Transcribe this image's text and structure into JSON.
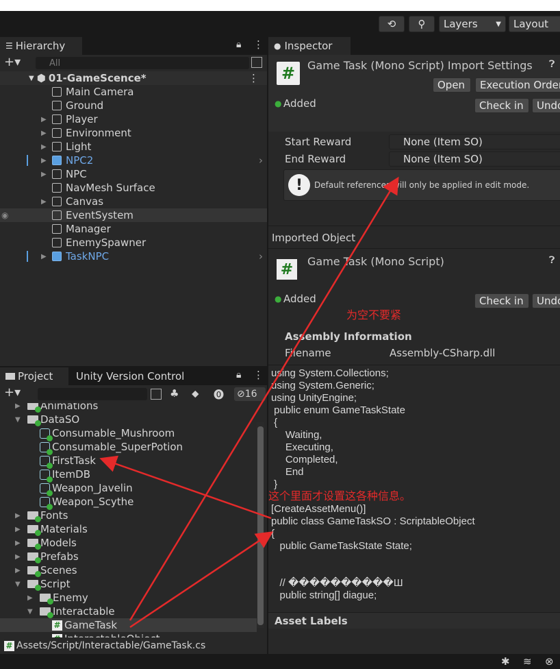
{
  "toolbar": {
    "layers": "Layers",
    "layout": "Layout"
  },
  "hierarchy": {
    "tab": "Hierarchy",
    "search_placeholder": "All",
    "scene": "01-GameScence*",
    "items": [
      {
        "label": "Main Camera"
      },
      {
        "label": "Ground"
      },
      {
        "label": "Player"
      },
      {
        "label": "Environment"
      },
      {
        "label": "Light"
      },
      {
        "label": "NPC2"
      },
      {
        "label": "NPC"
      },
      {
        "label": "NavMesh Surface"
      },
      {
        "label": "Canvas"
      },
      {
        "label": "EventSystem"
      },
      {
        "label": "Manager"
      },
      {
        "label": "EnemySpawner"
      },
      {
        "label": "TaskNPC"
      }
    ]
  },
  "inspector": {
    "tab": "Inspector",
    "title": "Game Task (Mono Script) Import Settings",
    "open": "Open",
    "exec_order": "Execution Order...",
    "added": "Added",
    "check_in": "Check in",
    "undo": "Undo",
    "start_reward_label": "Start Reward",
    "start_reward_value": "None (Item SO)",
    "end_reward_label": "End Reward",
    "end_reward_value": "None (Item SO)",
    "info_text": "Default references will only be applied in edit mode.",
    "imported_object": "Imported Object",
    "sub_title": "Game Task (Mono Script)",
    "assembly_info": "Assembly Information",
    "filename_label": "Filename",
    "filename_value": "Assembly-CSharp.dll",
    "asset_labels": "Asset Labels"
  },
  "code": {
    "lines": [
      "using System.Collections;",
      "using System.Generic;",
      "using UnityEngine;",
      " public enum GameTaskState",
      " {",
      "     Waiting,",
      "     Executing,",
      "     Completed,",
      "     End",
      " }",
      "",
      "[CreateAssetMenu()]",
      "public class GameTaskSO : ScriptableObject",
      "{",
      "   public GameTaskState State;",
      "",
      "",
      "   // ����������Ш",
      "   public string[] diague;"
    ]
  },
  "project": {
    "tab": "Project",
    "tab2": "Unity Version Control",
    "badge": "16",
    "items": [
      {
        "label": "Animations"
      },
      {
        "label": "DataSO"
      },
      {
        "label": "Consumable_Mushroom"
      },
      {
        "label": "Consumable_SuperPotion"
      },
      {
        "label": "FirstTask"
      },
      {
        "label": "ItemDB"
      },
      {
        "label": "Weapon_Javelin"
      },
      {
        "label": "Weapon_Scythe"
      },
      {
        "label": "Fonts"
      },
      {
        "label": "Materials"
      },
      {
        "label": "Models"
      },
      {
        "label": "Prefabs"
      },
      {
        "label": "Scenes"
      },
      {
        "label": "Script"
      },
      {
        "label": "Enemy"
      },
      {
        "label": "Interactable"
      },
      {
        "label": "GameTask"
      },
      {
        "label": "InteractableObject"
      }
    ],
    "path": "Assets/Script/Interactable/GameTask.cs"
  },
  "annotations": {
    "empty_ok": "为空不要紧",
    "set_here": "这个里面才设置这各种信息。"
  },
  "colors": {
    "accent_blue": "#5a9fe0",
    "annotation_red": "#e42a2a",
    "added_green": "#3cae3c"
  }
}
